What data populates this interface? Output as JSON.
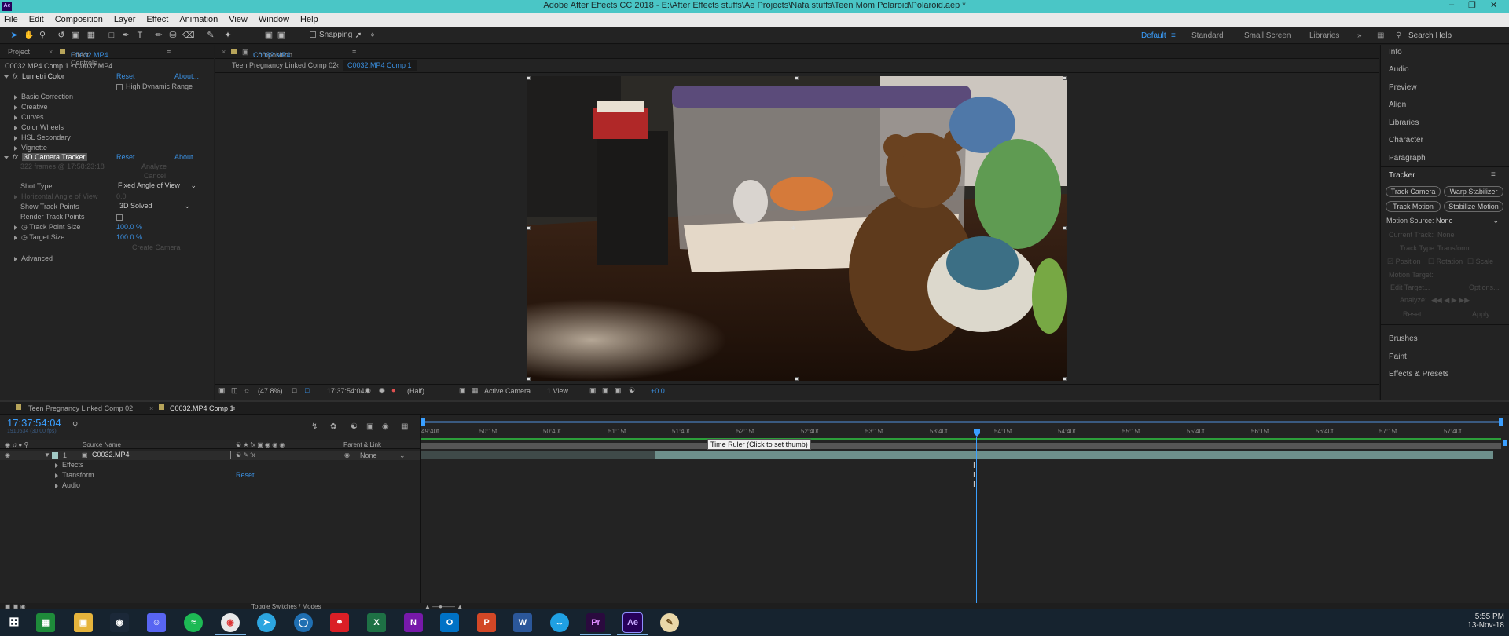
{
  "app": {
    "logo": "Ae",
    "title": "Adobe After Effects CC 2018 - E:\\After Effects stuffs\\Ae Projects\\Nafa stuffs\\Teen Mom Polaroid\\Polaroid.aep *"
  },
  "menu": [
    "File",
    "Edit",
    "Composition",
    "Layer",
    "Effect",
    "Animation",
    "View",
    "Window",
    "Help"
  ],
  "toolbar": {
    "snapping_label": "Snapping",
    "workspaces": [
      "Default",
      "Standard",
      "Small Screen",
      "Libraries"
    ],
    "active_workspace": "Default",
    "search_placeholder": "Search Help"
  },
  "effect_controls": {
    "tab_project": "Project",
    "tab_effect_controls": "Effect Controls",
    "tab_layer_name": "C0032.MP4",
    "breadcrumb": "C0032.MP4 Comp 1 • C0032.MP4",
    "lumetri": {
      "name": "Lumetri Color",
      "reset": "Reset",
      "about": "About...",
      "hdr_label": "High Dynamic Range",
      "sections": [
        "Basic Correction",
        "Creative",
        "Curves",
        "Color Wheels",
        "HSL Secondary",
        "Vignette"
      ]
    },
    "tracker": {
      "name": "3D Camera Tracker",
      "reset": "Reset",
      "about": "About...",
      "frames_info": "322 frames @ 17:58:23:18",
      "analyze_btn": "Analyze",
      "cancel_btn": "Cancel",
      "shot_type_label": "Shot Type",
      "shot_type_value": "Fixed Angle of View",
      "hfov_label": "Horizontal Angle of View",
      "hfov_value": "0.0",
      "show_tp_label": "Show Track Points",
      "show_tp_value": "3D Solved",
      "render_tp_label": "Render Track Points",
      "tp_size_label": "Track Point Size",
      "tp_size_value": "100.0 %",
      "target_size_label": "Target Size",
      "target_size_value": "100.0 %",
      "create_camera_btn": "Create Camera",
      "advanced_label": "Advanced"
    }
  },
  "composition": {
    "tab_label": "Composition",
    "tab_comp_name": "C0032.MP4 Comp 1",
    "breadcrumb_parent": "Teen Pregnancy Linked Comp 02",
    "breadcrumb_current": "C0032.MP4 Comp 1",
    "footer": {
      "zoom": "(47.8%)",
      "timecode": "17:37:54:04",
      "resolution": "(Half)",
      "camera": "Active Camera",
      "views": "1 View",
      "exposure": "+0.0"
    }
  },
  "right_panel": {
    "items_top": [
      "Info",
      "Audio",
      "Preview",
      "Align",
      "Libraries",
      "Character",
      "Paragraph"
    ],
    "tracker_title": "Tracker",
    "buttons": [
      "Track Camera",
      "Warp Stabilizer",
      "Track Motion",
      "Stabilize Motion"
    ],
    "motion_source_label": "Motion Source:",
    "motion_source_value": "None",
    "current_track_label": "Current Track:",
    "current_track_value": "None",
    "track_type_label": "Track Type:",
    "track_type_value": "Transform",
    "position_label": "Position",
    "rotation_label": "Rotation",
    "scale_label": "Scale",
    "motion_target_label": "Motion Target:",
    "edit_target_btn": "Edit Target...",
    "options_btn": "Options...",
    "analyze_label": "Analyze:",
    "reset_btn": "Reset",
    "apply_btn": "Apply",
    "items_bottom": [
      "Brushes",
      "Paint",
      "Effects & Presets"
    ]
  },
  "timeline": {
    "tabs": [
      "Teen Pregnancy Linked Comp 02",
      "C0032.MP4 Comp 1"
    ],
    "timecode": "17:37:54:04",
    "sub_timecode": "1910534 (30.00 fps)",
    "col_source_name": "Source Name",
    "col_parent": "Parent & Link",
    "layer_number": "1",
    "layer_name": "C0032.MP4",
    "parent_value": "None",
    "sublayers": [
      "Effects",
      "Transform",
      "Audio"
    ],
    "transform_reset": "Reset",
    "ruler_labels": [
      "49:40f",
      "50:15f",
      "50:40f",
      "51:15f",
      "51:40f",
      "52:15f",
      "52:40f",
      "53:15f",
      "53:40f",
      "54:15f",
      "54:40f",
      "55:15f",
      "55:40f",
      "56:15f",
      "56:40f",
      "57:15f",
      "57:40f"
    ],
    "tooltip": "Time Ruler (Click to set thumb)",
    "toggle_label": "Toggle Switches / Modes"
  },
  "taskbar": {
    "time": "5:55 PM",
    "date": "13-Nov-18"
  }
}
